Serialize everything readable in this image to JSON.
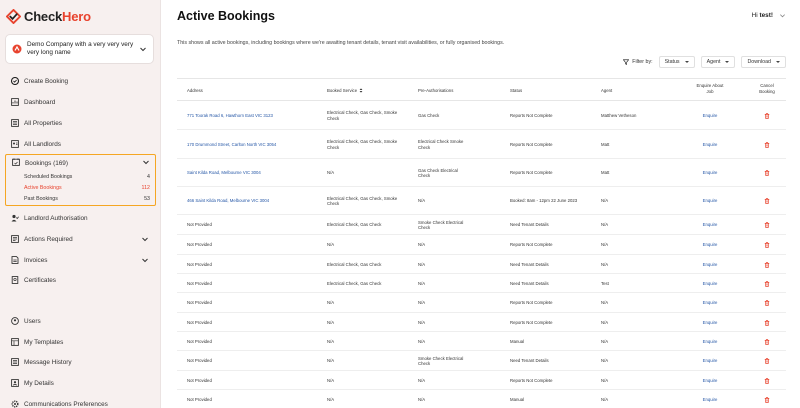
{
  "brand": {
    "check": "Check",
    "hero": "Hero",
    "accent": "#e8432e"
  },
  "company": {
    "name": "Demo Company with a very very very very long name"
  },
  "nav": {
    "create_booking": "Create Booking",
    "dashboard": "Dashboard",
    "all_properties": "All Properties",
    "all_landlords": "All Landlords",
    "bookings": {
      "label": "Bookings (169)",
      "items": [
        {
          "label": "Scheduled Bookings",
          "count": "4"
        },
        {
          "label": "Active Bookings",
          "count": "112"
        },
        {
          "label": "Past Bookings",
          "count": "53"
        }
      ]
    },
    "landlord_authorisation": "Landlord Authorisation",
    "actions_required": "Actions Required",
    "invoices": "Invoices",
    "certificates": "Certificates",
    "users": "Users",
    "my_templates": "My Templates",
    "message_history": "Message History",
    "my_details": "My Details",
    "communications_preferences": "Communications Preferences"
  },
  "header": {
    "title": "Active Bookings",
    "greeting_prefix": "Hi",
    "greeting_name": "test!",
    "subtitle": "This shows all active bookings, including bookings where we're awaiting tenant details, tenant visit availabilities, or fully organised bookings."
  },
  "filters": {
    "label": "Filter by:",
    "status": "Status",
    "agent": "Agent",
    "download": "Download"
  },
  "table": {
    "columns": {
      "address": "Address",
      "booked_service": "Booked Service",
      "pre_auth": "Pre-Authorisations",
      "status": "Status",
      "agent": "Agent",
      "enquire_1": "Enquire About",
      "enquire_2": "Job",
      "cancel_1": "Cancel",
      "cancel_2": "Booking"
    },
    "enquire_label": "Enquire",
    "rows": [
      {
        "address": "771 Toorak Road 6, Hawthorn East VIC 3123",
        "service": "Electrical Check, Gas Check, Smoke Check",
        "preauth": "Gas Check",
        "status": "Reports Not Complete",
        "agent": "Matthew Vetheson"
      },
      {
        "address": "170 Drummond Street, Carlton North VIC 3054",
        "service": "Electrical Check, Gas Check, Smoke Check",
        "preauth": "Electrical Check Smoke Check",
        "status": "Reports Not Complete",
        "agent": "Matt"
      },
      {
        "address": "Saint Kilda Road, Melbourne VIC 3004",
        "service": "N/A",
        "preauth": "Gas Check Electrical Check",
        "status": "Reports Not Complete",
        "agent": "Matt"
      },
      {
        "address": "466 Saint Kilda Road, Melbourne VIC 3004",
        "service": "Electrical Check, Gas Check, Smoke Check",
        "preauth": "N/A",
        "status": "Booked: 8am - 12pm 22 June 2023",
        "agent": "N/A"
      },
      {
        "address": "Not Provided",
        "service": "Electrical Check, Gas Check",
        "preauth": "Smoke Check Electrical Check",
        "status": "Need Tenant Details",
        "agent": "N/A"
      },
      {
        "address": "Not Provided",
        "service": "N/A",
        "preauth": "N/A",
        "status": "Reports Not Complete",
        "agent": "N/A"
      },
      {
        "address": "Not Provided",
        "service": "Electrical Check, Gas Check",
        "preauth": "N/A",
        "status": "Need Tenant Details",
        "agent": "N/A"
      },
      {
        "address": "Not Provided",
        "service": "Electrical Check, Gas Check",
        "preauth": "N/A",
        "status": "Need Tenant Details",
        "agent": "Test"
      },
      {
        "address": "Not Provided",
        "service": "N/A",
        "preauth": "N/A",
        "status": "Reports Not Complete",
        "agent": "N/A"
      },
      {
        "address": "Not Provided",
        "service": "N/A",
        "preauth": "N/A",
        "status": "Reports Not Complete",
        "agent": "N/A"
      },
      {
        "address": "Not Provided",
        "service": "N/A",
        "preauth": "N/A",
        "status": "Manual",
        "agent": "N/A"
      },
      {
        "address": "Not Provided",
        "service": "N/A",
        "preauth": "Smoke Check Electrical Check",
        "status": "Need Tenant Details",
        "agent": "N/A"
      },
      {
        "address": "Not Provided",
        "service": "N/A",
        "preauth": "N/A",
        "status": "Reports Not Complete",
        "agent": "N/A"
      },
      {
        "address": "Not Provided",
        "service": "N/A",
        "preauth": "N/A",
        "status": "Manual",
        "agent": "N/A"
      }
    ]
  }
}
